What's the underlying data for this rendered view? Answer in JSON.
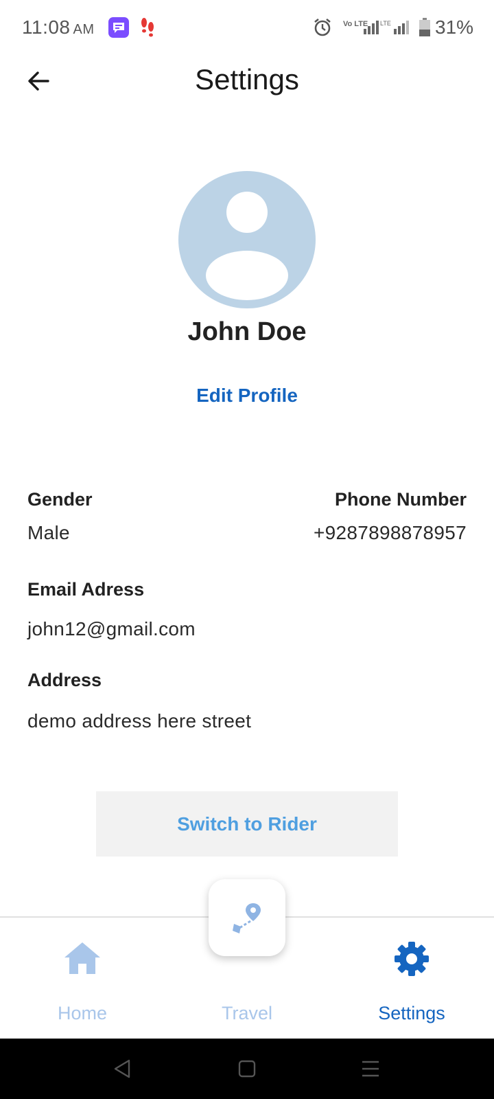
{
  "status_bar": {
    "time": "11:08",
    "ampm": "AM",
    "battery_percent": "31%",
    "network_label": "Vo LTE",
    "icons": [
      "chat-app-icon",
      "footsteps-icon",
      "alarm-icon",
      "volte-icon",
      "signal-icon",
      "battery-icon"
    ]
  },
  "header": {
    "title": "Settings",
    "back_icon": "arrow-left-icon"
  },
  "profile": {
    "name": "John Doe",
    "edit_label": "Edit Profile",
    "avatar_icon": "person-placeholder-icon"
  },
  "details": {
    "gender": {
      "label": "Gender",
      "value": "Male"
    },
    "phone": {
      "label": "Phone Number",
      "value": "+9287898878957"
    },
    "email": {
      "label": "Email Adress",
      "value": "john12@gmail.com"
    },
    "address": {
      "label": "Address",
      "value": "demo address here street"
    }
  },
  "switch_button": {
    "label": "Switch to Rider"
  },
  "bottom_nav": {
    "items": [
      {
        "label": "Home",
        "icon": "home-icon",
        "active": false
      },
      {
        "label": "Travel",
        "icon": "route-pin-icon",
        "active": false
      },
      {
        "label": "Settings",
        "icon": "gear-icon",
        "active": true
      }
    ]
  },
  "colors": {
    "accent": "#1565c0",
    "inactive_nav": "#a9c6ea",
    "avatar_bg": "#bcd3e6",
    "switch_text": "#4f9fe0",
    "switch_bg": "#f2f2f2"
  }
}
